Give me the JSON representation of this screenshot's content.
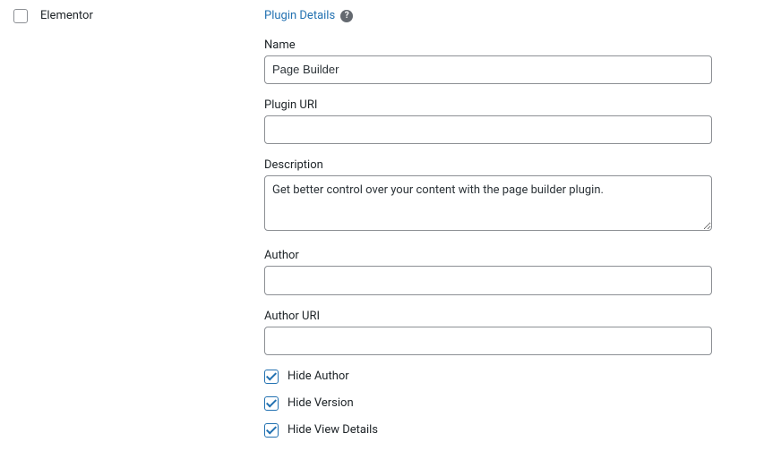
{
  "row": {
    "plugin_name": "Elementor",
    "selected": false
  },
  "details": {
    "section_title": "Plugin Details",
    "fields": {
      "name": {
        "label": "Name",
        "value": "Page Builder"
      },
      "plugin_uri": {
        "label": "Plugin URI",
        "value": ""
      },
      "description": {
        "label": "Description",
        "value": "Get better control over your content with the page builder plugin."
      },
      "author": {
        "label": "Author",
        "value": ""
      },
      "author_uri": {
        "label": "Author URI",
        "value": ""
      }
    },
    "checkboxes": {
      "hide_author": {
        "label": "Hide Author",
        "checked": true
      },
      "hide_version": {
        "label": "Hide Version",
        "checked": true
      },
      "hide_view_details": {
        "label": "Hide View Details",
        "checked": true
      }
    }
  }
}
